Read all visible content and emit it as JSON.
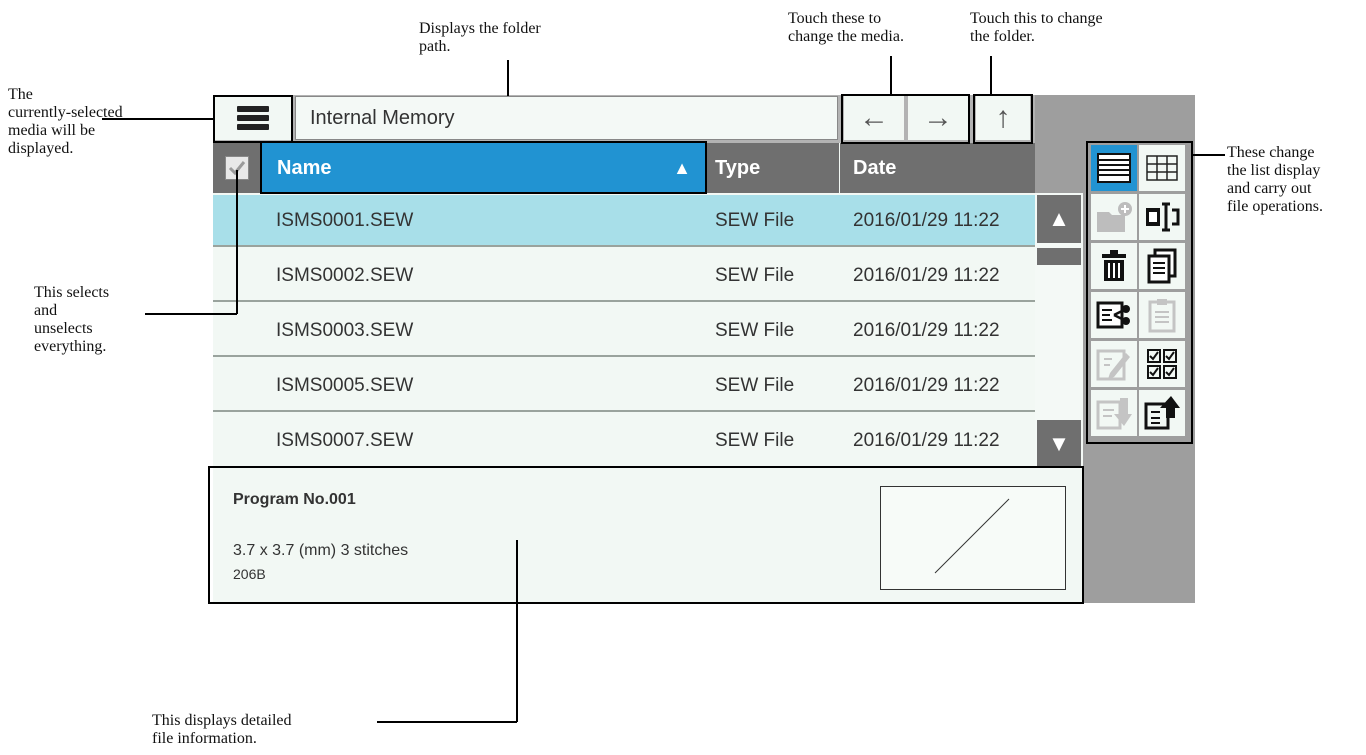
{
  "annotations": {
    "media": "The\ncurrently-selected\nmedia will be\ndisplayed.",
    "path": "Displays   the   folder\npath.",
    "change_media": "Touch these to\nchange the media.",
    "change_folder": "Touch this to change\nthe folder.",
    "list_ops": "These change\nthe list display\nand carry out\nfile operations.",
    "select_all": "This selects\nand\nunselects\neverything.",
    "detail": "This displays detailed\nfile information."
  },
  "path": {
    "value": "Internal Memory"
  },
  "nav": {
    "back_glyph": "←",
    "forward_glyph": "→",
    "up_glyph": "↑"
  },
  "table": {
    "headers": {
      "name": "Name",
      "type": "Type",
      "date": "Date",
      "sort_glyph": "▲"
    },
    "rows": [
      {
        "name": "ISMS0001.SEW",
        "type": "SEW File",
        "date": "2016/01/29 11:22"
      },
      {
        "name": "ISMS0002.SEW",
        "type": "SEW File",
        "date": "2016/01/29 11:22"
      },
      {
        "name": "ISMS0003.SEW",
        "type": "SEW File",
        "date": "2016/01/29 11:22"
      },
      {
        "name": "ISMS0005.SEW",
        "type": "SEW File",
        "date": "2016/01/29 11:22"
      },
      {
        "name": "ISMS0007.SEW",
        "type": "SEW File",
        "date": "2016/01/29 11:22"
      }
    ],
    "selected_row": 0
  },
  "scroll": {
    "up_glyph": "▲",
    "down_glyph": "▼"
  },
  "info": {
    "title": "Program No.001",
    "size": "3.7 x 3.7 (mm) 3 stitches",
    "bytes": "206B"
  },
  "tools": [
    "list-view-icon",
    "grid-view-icon",
    "new-folder-icon",
    "rename-icon",
    "delete-icon",
    "copy-icon",
    "cut-icon",
    "paste-icon",
    "edit-icon",
    "select-multiple-icon",
    "import-icon",
    "export-icon"
  ],
  "colors": {
    "header_accent": "#2193d2",
    "header_bg": "#6f6f6f",
    "selected_row": "#a8dfe9"
  }
}
